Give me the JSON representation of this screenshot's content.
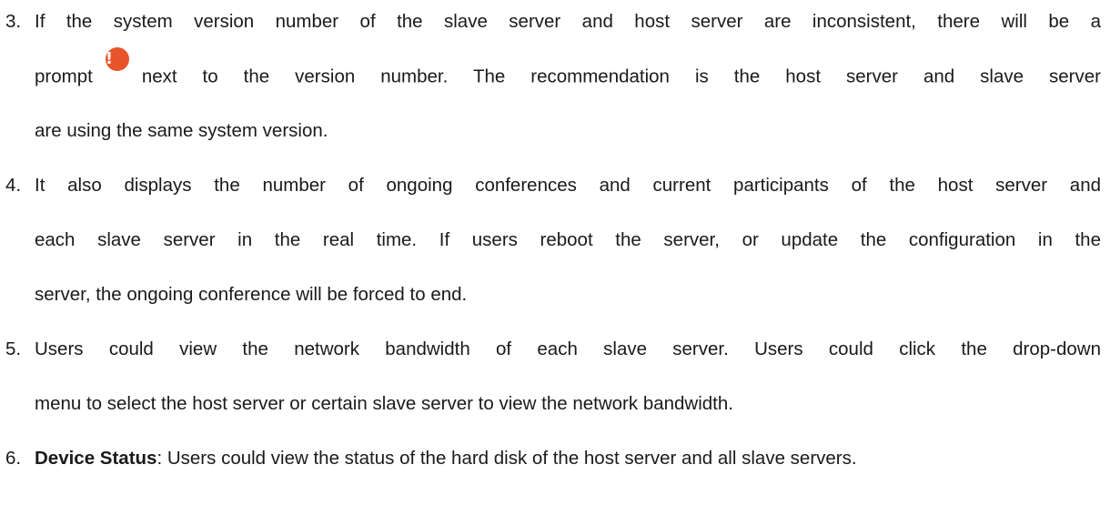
{
  "items": [
    {
      "number": "3.",
      "line1": "If the system version number of the slave server and host server are inconsistent, there will be a",
      "line2_before": "prompt",
      "icon": "exclamation-warning-icon",
      "icon_glyph": "!",
      "icon_color": "#e8542a",
      "line2_after": "next to the version number. The recommendation is the host server and slave server",
      "line3": "are using the same system version."
    },
    {
      "number": "4.",
      "line1": "It also displays the number of ongoing conferences and current participants of the host server and",
      "line2": "each slave server in the real time. If users reboot the server, or update the configuration in the",
      "line3": "server, the ongoing conference will be forced to end."
    },
    {
      "number": "5.",
      "line1": "Users could view the network bandwidth of each slave server. Users could click the drop-down",
      "line2": "menu to select the host server or certain slave server to view the network bandwidth."
    },
    {
      "number": "6.",
      "bold": "Device Status",
      "rest": ": Users could view the status of the hard disk of the host server and all slave servers."
    }
  ]
}
